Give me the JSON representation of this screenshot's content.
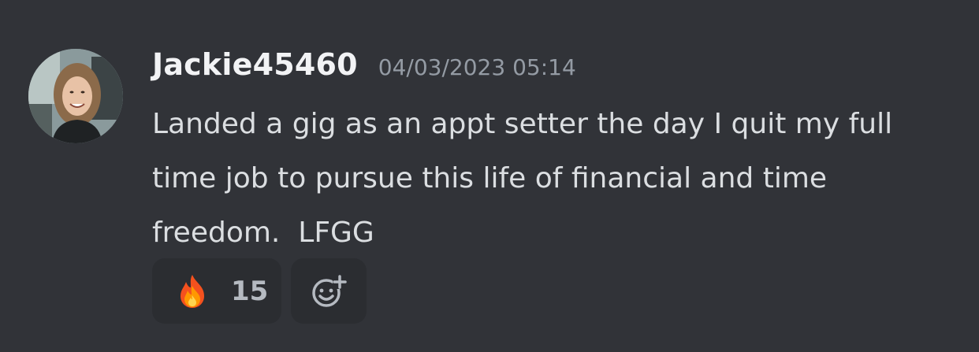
{
  "message": {
    "username": "Jackie45460",
    "timestamp": "04/03/2023 05:14",
    "content": "Landed a gig as an appt setter the day I quit my full time job to pursue this life of financial and time freedom.  LFGG",
    "avatar_icon": "user-avatar-photo"
  },
  "reactions": [
    {
      "emoji_icon": "fire-emoji-icon",
      "count": "15"
    }
  ],
  "add_reaction_icon": "add-reaction-icon",
  "colors": {
    "background": "#313338",
    "reaction_background": "#2b2d31",
    "username": "#f2f3f5",
    "timestamp": "#949ba4",
    "content": "#dbdee1",
    "count": "#b5bac1"
  }
}
